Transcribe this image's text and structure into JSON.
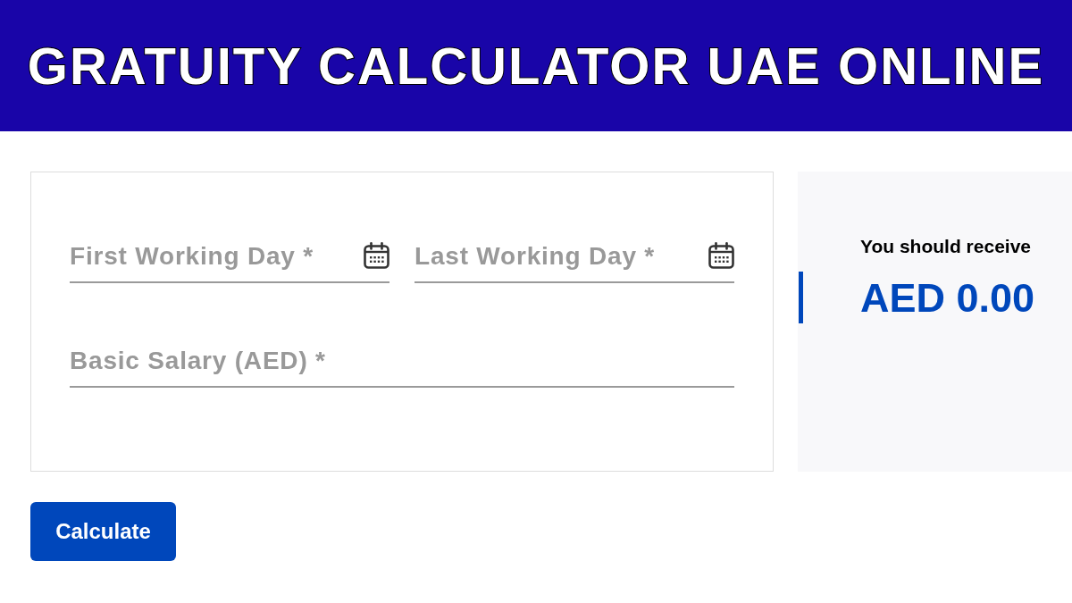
{
  "banner": {
    "title": "GRATUITY CALCULATOR UAE ONLINE"
  },
  "form": {
    "fields": [
      {
        "kind": "date",
        "placeholder": "First Working Day *"
      },
      {
        "kind": "date",
        "placeholder": "Last Working Day *"
      },
      {
        "kind": "number",
        "placeholder": "Basic Salary (AED) *"
      }
    ]
  },
  "result": {
    "label": "You should receive",
    "amount": "AED 0.00"
  },
  "buttons": [
    {
      "label": "Calculate"
    }
  ]
}
